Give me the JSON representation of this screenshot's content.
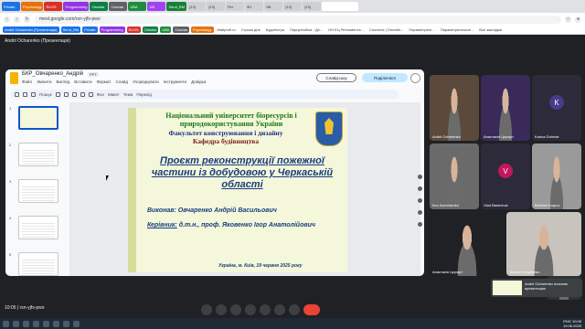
{
  "browser": {
    "tabs": [
      {
        "label": "Private",
        "color": "#1a73e8"
      },
      {
        "label": "Psychology",
        "color": "#e8710a"
      },
      {
        "label": "RUSS",
        "color": "#d93025"
      },
      {
        "label": "Programming",
        "color": "#9334e6"
      },
      {
        "label": "Obsidia",
        "color": "#0b8043"
      },
      {
        "label": "Canvas",
        "color": "#5f6368"
      },
      {
        "label": "UBA",
        "color": "#1e8e3e"
      },
      {
        "label": "UB",
        "color": "#a142f4"
      },
      {
        "label": "Send_BM",
        "color": "#188038"
      },
      {
        "label": "(13)",
        "color": ""
      },
      {
        "label": "(13)",
        "color": ""
      },
      {
        "label": "Рег",
        "color": ""
      },
      {
        "label": "Ф1",
        "color": ""
      },
      {
        "label": "ЗВ",
        "color": ""
      },
      {
        "label": "(13)",
        "color": ""
      },
      {
        "label": "(13)",
        "color": ""
      }
    ],
    "active_tab": "",
    "url": "meet.google.com/rsn-yjfs-pwo",
    "bookmarks": [
      {
        "label": "Andrii Ocharenko (Презентація)",
        "color": "#1a73e8",
        "light": false
      },
      {
        "label": "Send_BM",
        "color": "#1a73e8",
        "light": false
      },
      {
        "label": "Private",
        "color": "#1a73e8",
        "light": false
      },
      {
        "label": "Programming",
        "color": "#9334e6",
        "light": false
      },
      {
        "label": "RUSS",
        "color": "#d93025",
        "light": false
      },
      {
        "label": "Obsidia",
        "color": "#0b8043",
        "light": false
      },
      {
        "label": "UBA",
        "color": "#1e8e3e",
        "light": false
      },
      {
        "label": "Canvas",
        "color": "#5f6368",
        "light": false
      },
      {
        "label": "Psychology",
        "color": "#e8710a",
        "light": false
      },
      {
        "label": "Mattprofi.ru",
        "color": "",
        "light": true
      },
      {
        "label": "Строки дня",
        "color": "",
        "light": true
      },
      {
        "label": "Будиністра",
        "color": "",
        "light": true
      },
      {
        "label": "Парцелізбіна - Де...",
        "color": "",
        "light": true
      },
      {
        "label": "НН ЕЦ Регламента...",
        "color": "",
        "light": true
      },
      {
        "label": "Coursera | Онлайн...",
        "color": "",
        "light": true
      },
      {
        "label": "Параметричн...",
        "color": "",
        "light": true
      },
      {
        "label": "Параметрическое...",
        "color": "",
        "light": true
      },
      {
        "label": "Все закладки",
        "color": "",
        "light": true
      }
    ]
  },
  "meet": {
    "presenter_label": "Andrii Ocharenko (Презентація)",
    "meeting_code": "10:05 | rsn-yjfs-pwo",
    "presenting_note": "Andrii Ocharenko починає презентацію",
    "participants": [
      {
        "name": "Andrii Ocharenko",
        "initial": "",
        "color": "#5b4a3b"
      },
      {
        "name": "Анастасія Циркун",
        "initial": "",
        "color": "#3a2a5a"
      },
      {
        "name": "Karina Dohnlar",
        "initial": "K",
        "color": "#4a3a8a"
      },
      {
        "name": "Ihor Averchenko",
        "initial": "",
        "color": "#6a6a6a"
      },
      {
        "name": "Vlad Bashchuk",
        "initial": "V",
        "color": "#c2185b"
      },
      {
        "name": "Bohdan Karpov",
        "initial": "",
        "color": "#9a9a9a"
      },
      {
        "name": "Анастасія Циркун",
        "initial": "",
        "color": "#202124"
      },
      {
        "name": "Yevhen Dmytrenko",
        "initial": "",
        "color": "#c8c4bd"
      },
      {
        "name": "",
        "initial": "",
        "color": "#2d3436"
      }
    ]
  },
  "docs": {
    "title": "БКР_Овчаренко_Андрій",
    "badge": "PPT",
    "menu": [
      "Файл",
      "Змінити",
      "Вигляд",
      "Вставити",
      "Формат",
      "Слайд",
      "Упорядкувати",
      "Інструменти",
      "Довідка"
    ],
    "slideshow": "Слайд-шоу",
    "share": "Поділитися",
    "toolbar": [
      "Пошук",
      "Фон",
      "Макет",
      "Тема",
      "Перехід"
    ],
    "thumbnails": [
      "1",
      "2",
      "3",
      "4",
      "5"
    ]
  },
  "slide": {
    "university": "Національний університет біоресурсів і природокористування України",
    "faculty": "Факультет конструювання і дизайну",
    "department": "Кафедра будівництва",
    "project": "Проєкт реконструкції пожежної частини із добудовою у Черкаській області",
    "author_label": "Виконав:",
    "author_name": "Овчаренко Андрій Васильович",
    "supervisor_label": "Керівник:",
    "supervisor_name": "д.т.н., проф. Яковенко Ігор Анатолійович",
    "city_date": "Україна, м. Київ, 19 червня 2025 року"
  },
  "taskbar": {
    "time": "10:05",
    "date": "19.06.2025",
    "lang": "ENG"
  }
}
